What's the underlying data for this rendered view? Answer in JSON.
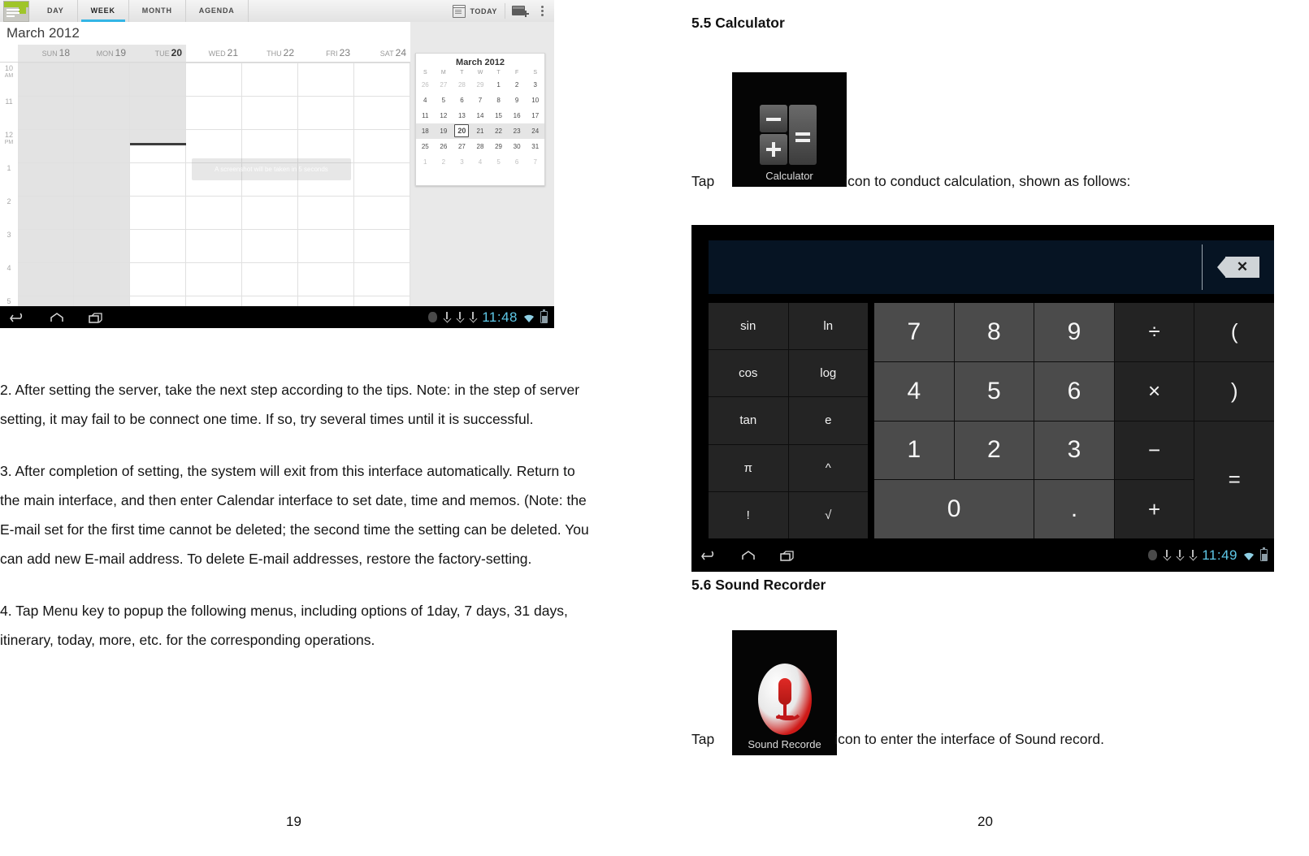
{
  "document": {
    "left_page_number": "19",
    "right_page_number": "20"
  },
  "calendar_screenshot": {
    "app_icon": "calendar-app-icon",
    "tabs": [
      {
        "label": "DAY",
        "active": false
      },
      {
        "label": "WEEK",
        "active": true
      },
      {
        "label": "MONTH",
        "active": false
      },
      {
        "label": "AGENDA",
        "active": false
      }
    ],
    "today_button": "TODAY",
    "new_event_icon": "new-event-icon",
    "overflow_icon": "overflow-menu-icon",
    "month_title": "March 2012",
    "days": [
      {
        "dow": "SUN",
        "num": "18",
        "past": true,
        "today": false
      },
      {
        "dow": "MON",
        "num": "19",
        "past": true,
        "today": false
      },
      {
        "dow": "TUE",
        "num": "20",
        "past": true,
        "today": true
      },
      {
        "dow": "WED",
        "num": "21",
        "past": false,
        "today": false
      },
      {
        "dow": "THU",
        "num": "22",
        "past": false,
        "today": false
      },
      {
        "dow": "FRI",
        "num": "23",
        "past": false,
        "today": false
      },
      {
        "dow": "SAT",
        "num": "24",
        "past": false,
        "today": false
      }
    ],
    "time_labels": [
      {
        "hour": "10",
        "meridiem": "AM"
      },
      {
        "hour": "11",
        "meridiem": ""
      },
      {
        "hour": "12",
        "meridiem": "PM"
      },
      {
        "hour": "1",
        "meridiem": ""
      },
      {
        "hour": "2",
        "meridiem": ""
      },
      {
        "hour": "3",
        "meridiem": ""
      },
      {
        "hour": "4",
        "meridiem": ""
      },
      {
        "hour": "5",
        "meridiem": ""
      }
    ],
    "toast": "A screenshot will be taken in 5 seconds",
    "mini_month": {
      "title": "March 2012",
      "dow": [
        "S",
        "M",
        "T",
        "W",
        "T",
        "F",
        "S"
      ],
      "weeks": [
        {
          "highlight": false,
          "days": [
            {
              "n": "26",
              "out": true
            },
            {
              "n": "27",
              "out": true
            },
            {
              "n": "28",
              "out": true
            },
            {
              "n": "29",
              "out": true
            },
            {
              "n": "1",
              "out": false
            },
            {
              "n": "2",
              "out": false
            },
            {
              "n": "3",
              "out": false
            }
          ]
        },
        {
          "highlight": false,
          "days": [
            {
              "n": "4",
              "out": false
            },
            {
              "n": "5",
              "out": false
            },
            {
              "n": "6",
              "out": false
            },
            {
              "n": "7",
              "out": false
            },
            {
              "n": "8",
              "out": false
            },
            {
              "n": "9",
              "out": false
            },
            {
              "n": "10",
              "out": false
            }
          ]
        },
        {
          "highlight": false,
          "days": [
            {
              "n": "11",
              "out": false
            },
            {
              "n": "12",
              "out": false
            },
            {
              "n": "13",
              "out": false
            },
            {
              "n": "14",
              "out": false
            },
            {
              "n": "15",
              "out": false
            },
            {
              "n": "16",
              "out": false
            },
            {
              "n": "17",
              "out": false
            }
          ]
        },
        {
          "highlight": true,
          "days": [
            {
              "n": "18",
              "out": false
            },
            {
              "n": "19",
              "out": false
            },
            {
              "n": "20",
              "out": false,
              "selected": true
            },
            {
              "n": "21",
              "out": false
            },
            {
              "n": "22",
              "out": false
            },
            {
              "n": "23",
              "out": false
            },
            {
              "n": "24",
              "out": false
            }
          ]
        },
        {
          "highlight": false,
          "days": [
            {
              "n": "25",
              "out": false
            },
            {
              "n": "26",
              "out": false
            },
            {
              "n": "27",
              "out": false
            },
            {
              "n": "28",
              "out": false
            },
            {
              "n": "29",
              "out": false
            },
            {
              "n": "30",
              "out": false
            },
            {
              "n": "31",
              "out": false
            }
          ]
        },
        {
          "highlight": false,
          "days": [
            {
              "n": "1",
              "out": true
            },
            {
              "n": "2",
              "out": true
            },
            {
              "n": "3",
              "out": true
            },
            {
              "n": "4",
              "out": true
            },
            {
              "n": "5",
              "out": true
            },
            {
              "n": "6",
              "out": true
            },
            {
              "n": "7",
              "out": true
            }
          ]
        }
      ]
    },
    "navbar": {
      "back_icon": "back-icon",
      "home_icon": "home-icon",
      "recents_icon": "recent-apps-icon",
      "clock": "11:48",
      "wifi_icon": "wifi-icon",
      "battery_icon": "battery-icon"
    }
  },
  "left_text": {
    "para2": "2. After setting the server, take the next step according to the tips. Note: in the step of server setting, it may fail to be connect one time. If so, try several times until it is successful.",
    "para3": "3. After completion of setting, the system will exit from this interface automatically. Return to the main interface, and then enter Calendar interface to set date, time and memos. (Note: the E-mail set for the first time cannot be deleted; the second time the setting can be deleted. You can add new E-mail address. To delete E-mail addresses, restore the factory-setting.",
    "para4": "4. Tap Menu key to popup the following menus, including options of 1day, 7 days, 31 days, itinerary, today, more, etc. for the corresponding operations."
  },
  "right_page": {
    "section_55_heading": "5.5 Calculator",
    "calculator_tile_label": "Calculator",
    "tap_prefix_calc": "Tap",
    "tap_suffix_calc": "icon to conduct calculation, shown as follows:",
    "section_56_heading": "5.6 Sound Recorder",
    "recorder_tile_label": "Sound Recordе",
    "tap_prefix_rec": "Tap",
    "tap_suffix_rec": "icon to enter the interface of Sound record."
  },
  "calculator_screenshot": {
    "display_value": "",
    "delete_icon": "backspace-delete-icon",
    "sci_keys": [
      "sin",
      "ln",
      "cos",
      "log",
      "tan",
      "e",
      "π",
      "^",
      "!",
      "√"
    ],
    "num_rows": [
      [
        "7",
        "8",
        "9",
        "÷",
        "("
      ],
      [
        "4",
        "5",
        "6",
        "×",
        ")"
      ],
      [
        "1",
        "2",
        "3",
        "−",
        "="
      ],
      [
        "0",
        ".",
        "+"
      ]
    ],
    "key_7": "7",
    "key_8": "8",
    "key_9": "9",
    "key_divide": "÷",
    "key_lparen": "(",
    "key_4": "4",
    "key_5": "5",
    "key_6": "6",
    "key_multiply": "×",
    "key_rparen": ")",
    "key_1": "1",
    "key_2": "2",
    "key_3": "3",
    "key_minus": "−",
    "key_equals": "=",
    "key_0": "0",
    "key_dot": ".",
    "key_plus": "+",
    "navbar": {
      "back_icon": "back-icon",
      "home_icon": "home-icon",
      "recents_icon": "recent-apps-icon",
      "clock": "11:49",
      "wifi_icon": "wifi-icon",
      "battery_icon": "battery-icon"
    }
  },
  "colors": {
    "tab_accent": "#33b5e5",
    "clock_blue": "#5ec8e8",
    "calc_display_bg": "#061423",
    "num_key_bg": "#4b4b4b",
    "op_key_bg": "#232323",
    "recorder_red": "#cf1a18"
  }
}
